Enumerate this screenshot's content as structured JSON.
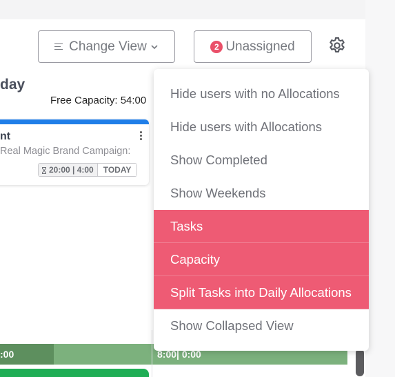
{
  "toolbar": {
    "change_view_label": "Change View",
    "unassigned_count": "2",
    "unassigned_label": "Unassigned",
    "settings_icon": "gear-icon"
  },
  "column": {
    "day_title": "day",
    "free_capacity": "Free Capacity: 54:00"
  },
  "task_card": {
    "title": "nt",
    "subtitle": "Real Magic Brand Campaign:",
    "hours": "20:00 | 4:00",
    "today_label": "TODAY",
    "accent_color": "#1f7ee8"
  },
  "capacity_bar": {
    "left_text": ":00",
    "right_text": "8:00| 0:00"
  },
  "settings_menu": {
    "items": [
      {
        "label": "Hide users with no Allocations",
        "active": false
      },
      {
        "label": "Hide users with Allocations",
        "active": false
      },
      {
        "label": "Show Completed",
        "active": false
      },
      {
        "label": "Show Weekends",
        "active": false
      },
      {
        "label": "Tasks",
        "active": true
      },
      {
        "label": "Capacity",
        "active": true
      },
      {
        "label": "Split Tasks into Daily Allocations",
        "active": true
      },
      {
        "label": "Show Collapsed View",
        "active": false
      }
    ],
    "active_color": "#ee5b74"
  }
}
